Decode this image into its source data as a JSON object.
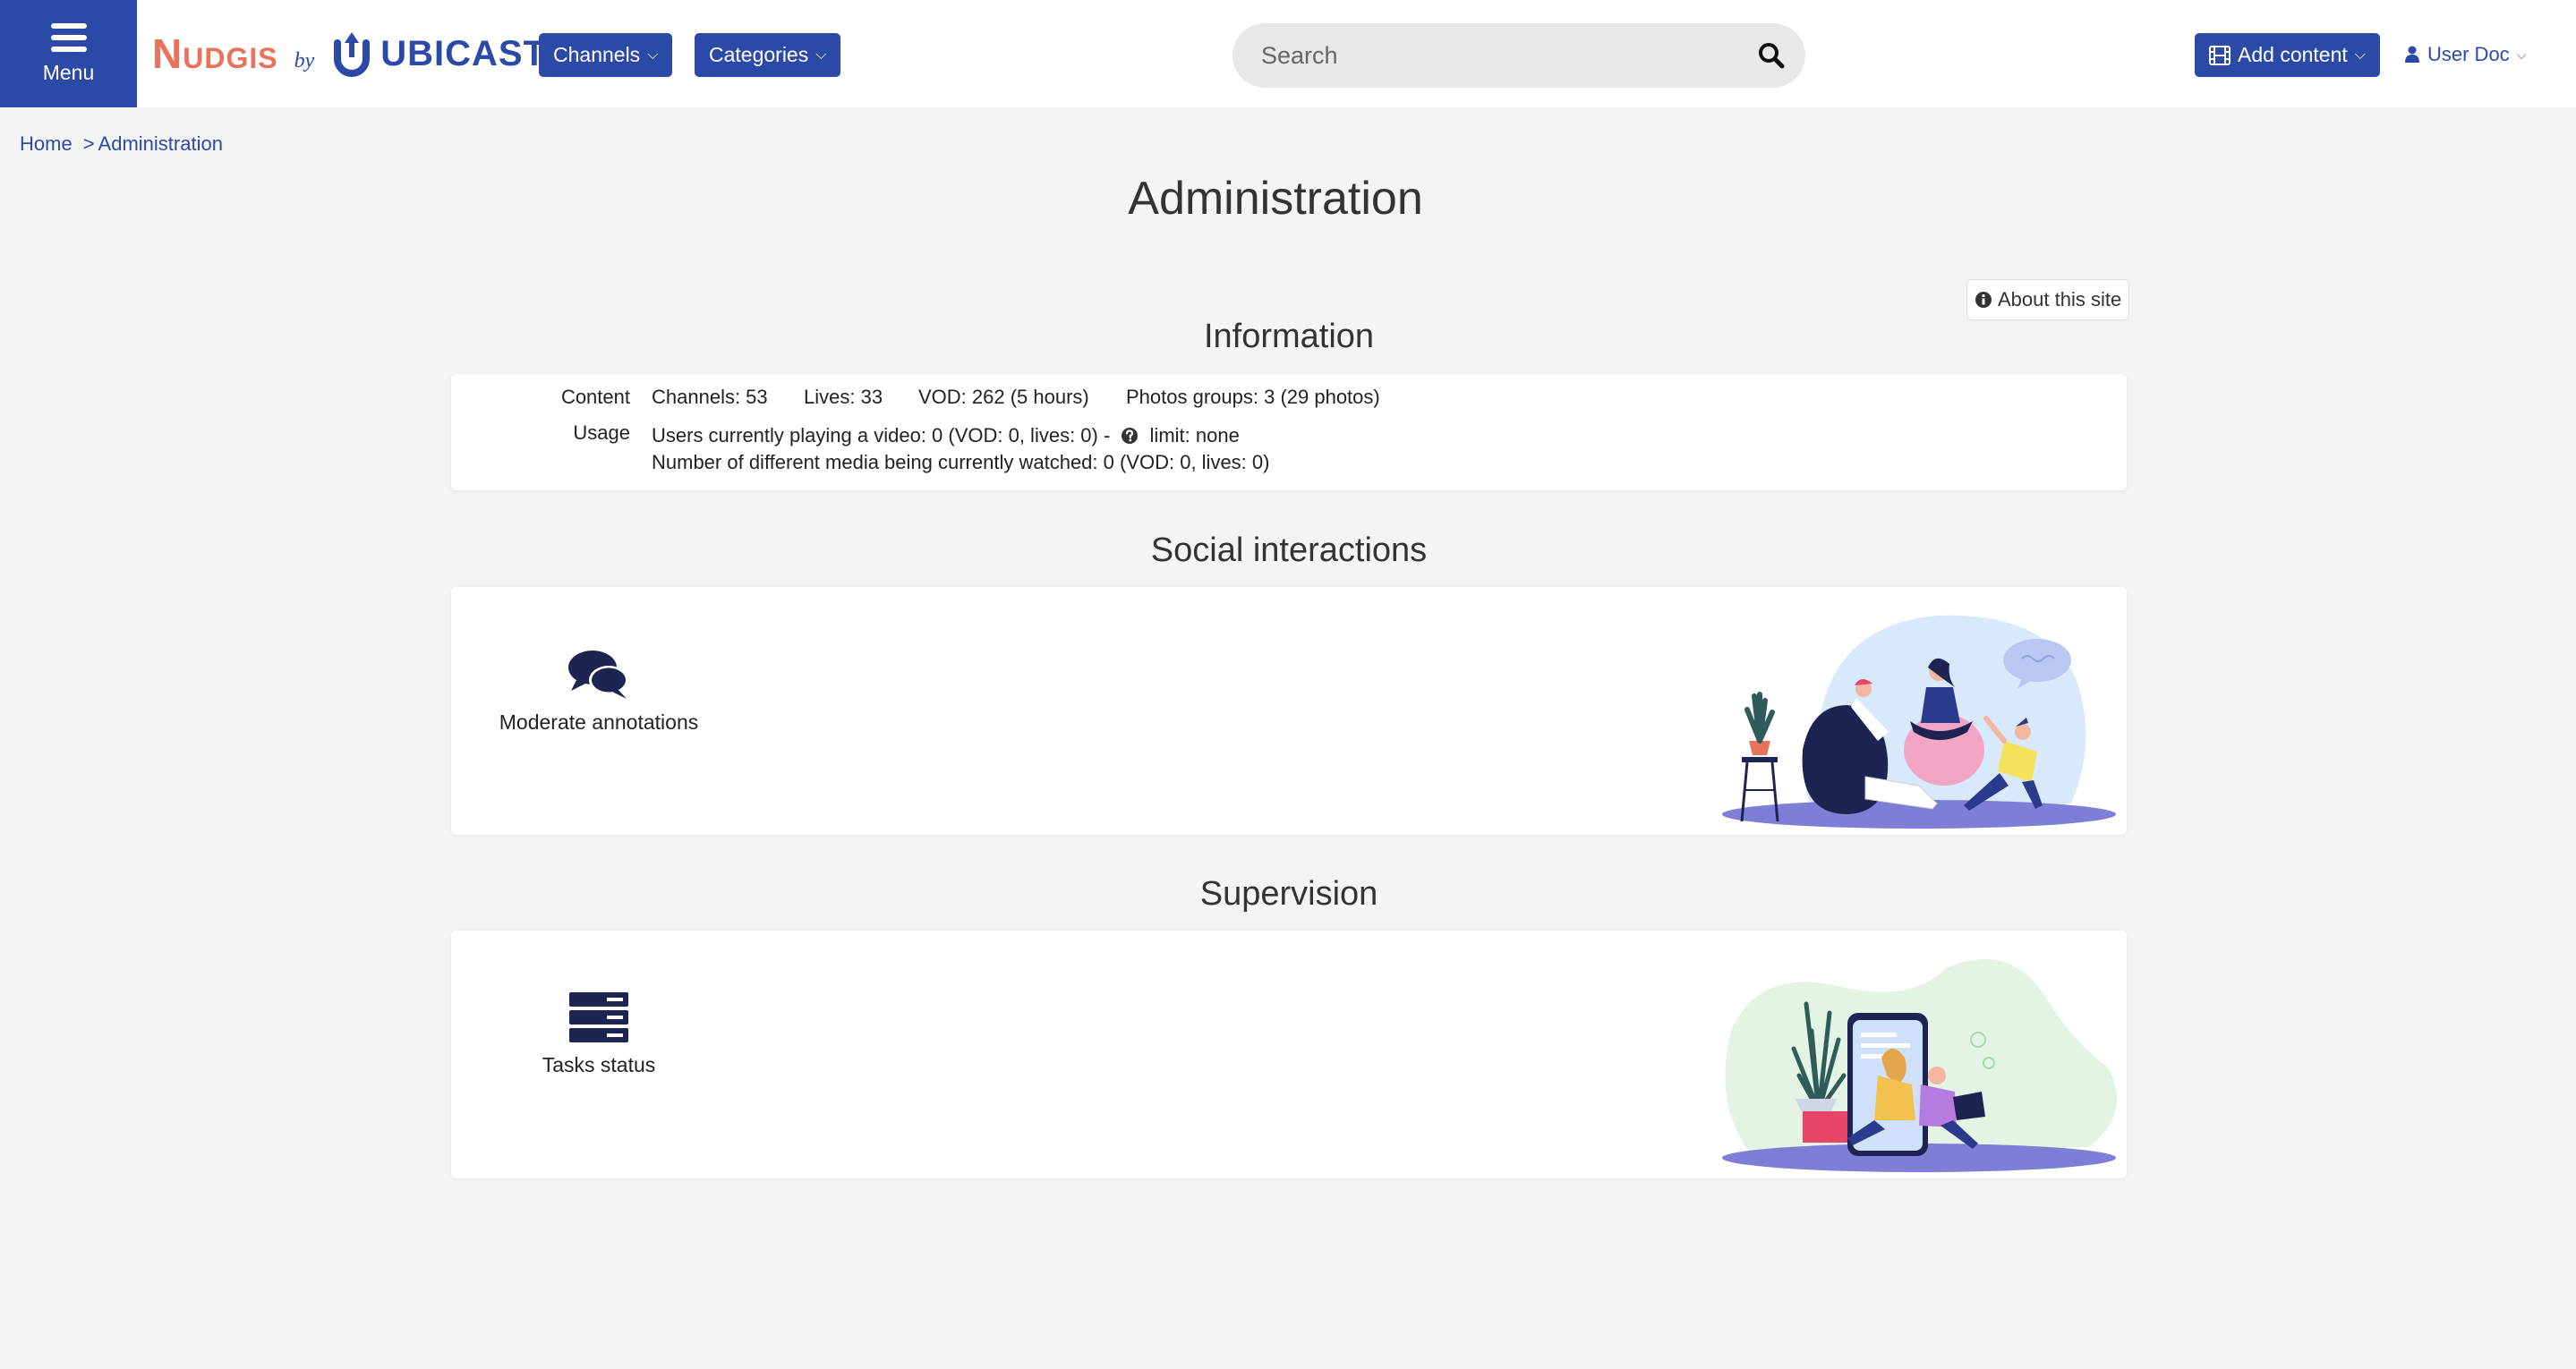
{
  "header": {
    "menu_label": "Menu",
    "logo_nudgis": "Nudgis",
    "logo_by": "by",
    "logo_ubicast": "UBICAST",
    "channels_label": "Channels",
    "categories_label": "Categories",
    "search_placeholder": "Search",
    "add_content_label": "Add content",
    "user_label": "User Doc"
  },
  "breadcrumb": {
    "home": "Home",
    "separator": ">",
    "current": "Administration"
  },
  "page": {
    "title": "Administration",
    "about_label": "About this site"
  },
  "information": {
    "title": "Information",
    "content_key": "Content",
    "channels": "Channels: 53",
    "lives": "Lives: 33",
    "vod": "VOD: 262 (5 hours)",
    "photos": "Photos groups: 3 (29 photos)",
    "usage_key": "Usage",
    "usage_line1": "Users currently playing a video: 0 (VOD: 0, lives: 0) -",
    "usage_limit": "limit: none",
    "usage_line2": "Number of different media being currently watched: 0 (VOD: 0, lives: 0)"
  },
  "social": {
    "title": "Social interactions",
    "tile_label": "Moderate annotations"
  },
  "supervision": {
    "title": "Supervision",
    "tile_label": "Tasks status"
  },
  "colors": {
    "primary": "#2b4aa8",
    "brand_orange": "#e8735a",
    "navy_icon": "#1d2451",
    "background": "#f4f4f4"
  },
  "icons": {
    "menu": "hamburger-icon",
    "search": "search-icon",
    "add_content": "film-icon",
    "user": "user-icon",
    "about": "info-circle-icon",
    "usage_help": "question-circle-icon",
    "annotations": "comments-icon",
    "tasks": "server-icon"
  }
}
